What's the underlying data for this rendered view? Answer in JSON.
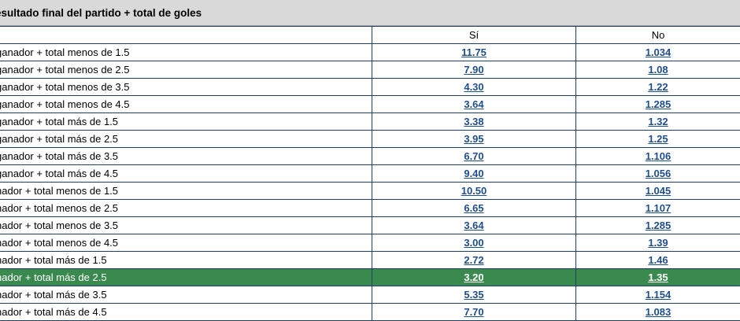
{
  "market": {
    "title": "esultado final del partido + total de goles"
  },
  "columns": {
    "yes": "Sí",
    "no": "No"
  },
  "rows": [
    {
      "label": "ganador + total menos de 1.5",
      "yes": "11.75",
      "no": "1.034"
    },
    {
      "label": "ganador + total menos de 2.5",
      "yes": "7.90",
      "no": "1.08"
    },
    {
      "label": "ganador + total menos de 3.5",
      "yes": "4.30",
      "no": "1.22"
    },
    {
      "label": "ganador + total menos de 4.5",
      "yes": "3.64",
      "no": "1.285"
    },
    {
      "label": "ganador + total más de 1.5",
      "yes": "3.38",
      "no": "1.32"
    },
    {
      "label": "ganador + total más de 2.5",
      "yes": "3.95",
      "no": "1.25"
    },
    {
      "label": "ganador + total más de 3.5",
      "yes": "6.70",
      "no": "1.106"
    },
    {
      "label": "ganador + total más de 4.5",
      "yes": "9.40",
      "no": "1.056"
    },
    {
      "label": "nador + total menos de 1.5",
      "yes": "10.50",
      "no": "1.045"
    },
    {
      "label": "nador + total menos de 2.5",
      "yes": "6.65",
      "no": "1.107"
    },
    {
      "label": "nador + total menos de 3.5",
      "yes": "3.64",
      "no": "1.285"
    },
    {
      "label": "nador + total menos de 4.5",
      "yes": "3.00",
      "no": "1.39"
    },
    {
      "label": "nador + total más de 1.5",
      "yes": "2.72",
      "no": "1.46"
    },
    {
      "label": "nador + total más de 2.5",
      "yes": "3.20",
      "no": "1.35",
      "selected": "both"
    },
    {
      "label": "nador + total más de 3.5",
      "yes": "5.35",
      "no": "1.154"
    },
    {
      "label": "nador + total más de 4.5",
      "yes": "7.70",
      "no": "1.083"
    }
  ],
  "colors": {
    "selected_bg": "#3a8a4f",
    "link": "#1f4e8c",
    "border": "#1f3f66",
    "header_bg": "#d9d9d9"
  }
}
